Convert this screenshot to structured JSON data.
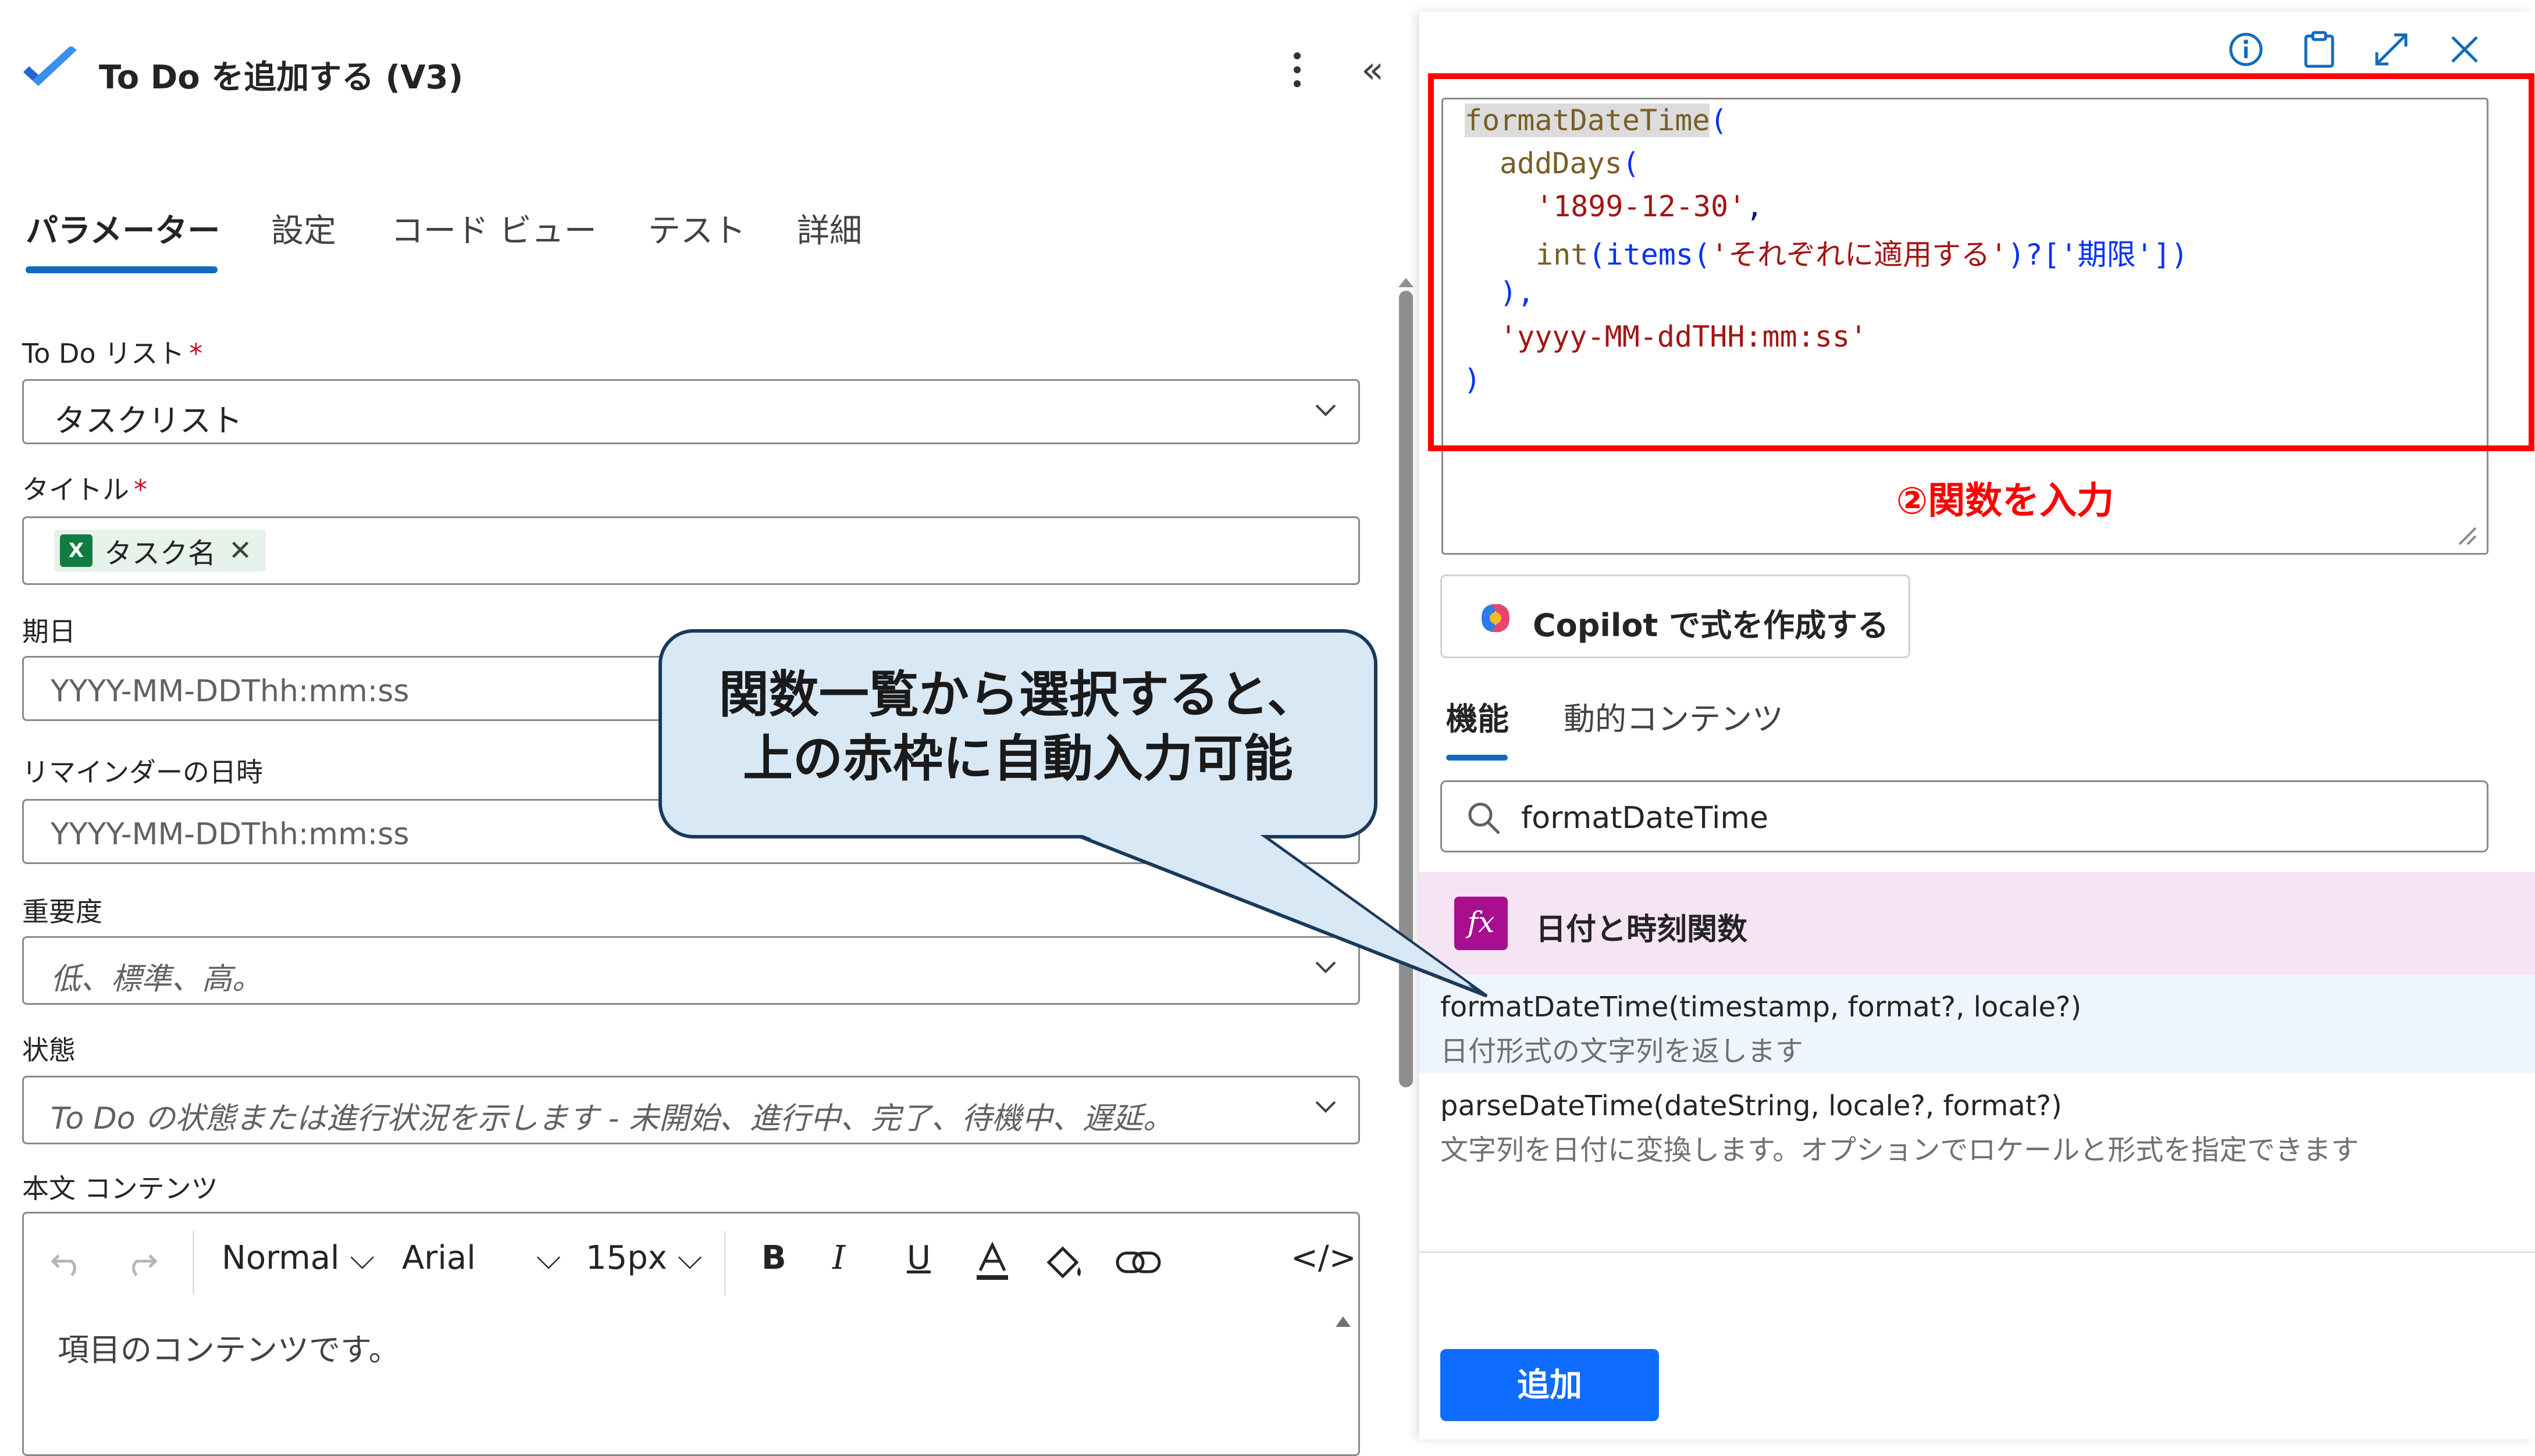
{
  "header": {
    "title": "To Do を追加する (V3)"
  },
  "tabs": [
    {
      "label": "パラメーター"
    },
    {
      "label": "設定"
    },
    {
      "label": "コード ビュー"
    },
    {
      "label": "テスト"
    },
    {
      "label": "詳細"
    }
  ],
  "fields": {
    "todo_list": {
      "label": "To Do リスト",
      "required_mark": "*",
      "value": "タスクリスト"
    },
    "title": {
      "label": "タイトル",
      "required_mark": "*",
      "token": "タスク名",
      "token_remove": "✕"
    },
    "due": {
      "label": "期日",
      "placeholder": "YYYY-MM-DDThh:mm:ss"
    },
    "reminder": {
      "label": "リマインダーの日時",
      "placeholder": "YYYY-MM-DDThh:mm:ss"
    },
    "importance": {
      "label": "重要度",
      "placeholder": "低、標準、高。"
    },
    "status": {
      "label": "状態",
      "placeholder": "To Do の状態または進行状況を示します - 未開始、進行中、完了、待機中、遅延。"
    },
    "body": {
      "label": "本文 コンテンツ",
      "content": "項目のコンテンツです。"
    }
  },
  "editor_toolbar": {
    "style": "Normal",
    "font": "Arial",
    "size": "15px",
    "bold": "B",
    "italic": "I",
    "underline": "U",
    "code": "</>"
  },
  "expression": {
    "lines": [
      {
        "fn": "formatDateTime",
        "rest": "("
      },
      {
        "fn": "addDays",
        "rest": "("
      },
      {
        "str": "'1899-12-30'",
        "rest": ","
      },
      {
        "fn": "int",
        "pre": "(items(",
        "str": "'それぞれに適用する'",
        "post": ")?['期限'])"
      },
      {
        "rest": "),"
      },
      {
        "str": "'yyyy-MM-ddTHH:mm:ss'"
      },
      {
        "rest": ")"
      }
    ]
  },
  "annotations": {
    "red_label": "②関数を入力",
    "callout_line1": "関数一覧から選択すると、",
    "callout_line2": "上の赤枠に自動入力可能"
  },
  "copilot": {
    "label": "Copilot で式を作成する"
  },
  "right_tabs": [
    {
      "label": "機能"
    },
    {
      "label": "動的コンテンツ"
    }
  ],
  "search": {
    "value": "formatDateTime"
  },
  "category": {
    "icon_label": "fx",
    "label": "日付と時刻関数"
  },
  "functions": [
    {
      "signature": "formatDateTime(timestamp, format?, locale?)",
      "description": "日付形式の文字列を返します"
    },
    {
      "signature": "parseDateTime(dateString, locale?, format?)",
      "description": "文字列を日付に変換します。オプションでロケールと形式を指定できます"
    }
  ],
  "add_button": {
    "label": "追加"
  },
  "colors": {
    "accent": "#0f6cbd",
    "add_button": "#0f6cff",
    "annotation_red": "#ff0000",
    "category_bg": "#f6e3f3",
    "fx_icon": "#a80f8f",
    "callout_bg": "#d9e8f5"
  },
  "icons": [
    "todo-check-icon",
    "more-vertical-icon",
    "collapse-chevrons-icon",
    "info-icon",
    "clipboard-icon",
    "expand-icon",
    "close-icon",
    "chevron-down-icon",
    "excel-icon",
    "search-icon",
    "copilot-icon",
    "fx-icon",
    "undo-icon",
    "redo-icon",
    "text-color-icon",
    "fill-color-icon",
    "link-icon"
  ]
}
